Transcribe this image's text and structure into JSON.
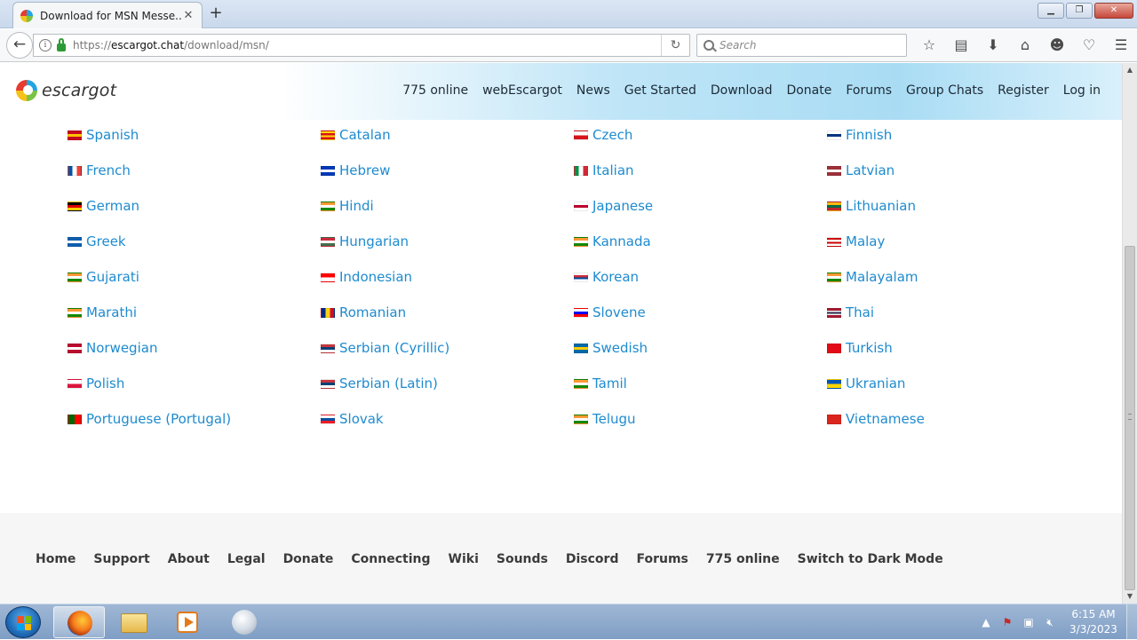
{
  "browser": {
    "tab_title": "Download for MSN Messe...",
    "tab_close": "✕",
    "new_tab": "+",
    "window_buttons": {
      "minimize": "▁",
      "maximize": "❐",
      "close": "✕"
    },
    "url_scheme": "https://",
    "url_host": "escargot.chat",
    "url_path": "/download/msn/",
    "search_placeholder": "Search",
    "toolbar_icons": [
      "bookmark-star-icon",
      "library-icon",
      "download-icon",
      "home-icon",
      "chat-icon",
      "pocket-icon",
      "menu-icon"
    ]
  },
  "site": {
    "logo_text": "escargot",
    "nav": [
      "775 online",
      "webEscargot",
      "News",
      "Get Started",
      "Download",
      "Donate",
      "Forums",
      "Group Chats",
      "Register",
      "Log in"
    ]
  },
  "languages": [
    [
      {
        "name": "Spanish",
        "flag": [
          "#c60b1e",
          "#ffc400",
          "#c60b1e"
        ]
      },
      {
        "name": "French",
        "flag": [
          "#0055a4",
          "#ffffff",
          "#ef4135"
        ],
        "vertical": true
      },
      {
        "name": "German",
        "flag": [
          "#000000",
          "#dd0000",
          "#ffce00"
        ]
      },
      {
        "name": "Greek",
        "flag": [
          "#0d5eaf",
          "#ffffff",
          "#0d5eaf"
        ]
      },
      {
        "name": "Gujarati",
        "flag": [
          "#ff9933",
          "#ffffff",
          "#138808"
        ]
      },
      {
        "name": "Marathi",
        "flag": [
          "#ff9933",
          "#ffffff",
          "#138808"
        ]
      },
      {
        "name": "Norwegian",
        "flag": [
          "#ba0c2f",
          "#ffffff",
          "#ba0c2f"
        ]
      },
      {
        "name": "Polish",
        "flag": [
          "#ffffff",
          "#dc143c"
        ]
      },
      {
        "name": "Portuguese (Portugal)",
        "flag": [
          "#006600",
          "#ff0000"
        ],
        "vertical": true
      }
    ],
    [
      {
        "name": "Catalan",
        "flag": [
          "#fcdd09",
          "#da121a",
          "#fcdd09",
          "#da121a"
        ]
      },
      {
        "name": "Hebrew",
        "flag": [
          "#0038b8",
          "#ffffff",
          "#0038b8"
        ]
      },
      {
        "name": "Hindi",
        "flag": [
          "#ff9933",
          "#ffffff",
          "#138808"
        ]
      },
      {
        "name": "Hungarian",
        "flag": [
          "#cd2a3e",
          "#ffffff",
          "#436f4d"
        ]
      },
      {
        "name": "Indonesian",
        "flag": [
          "#ff0000",
          "#ffffff"
        ]
      },
      {
        "name": "Romanian",
        "flag": [
          "#002b7f",
          "#fcd116",
          "#ce1126"
        ],
        "vertical": true
      },
      {
        "name": "Serbian (Cyrillic)",
        "flag": [
          "#c6363c",
          "#0c4076",
          "#ffffff"
        ]
      },
      {
        "name": "Serbian (Latin)",
        "flag": [
          "#c6363c",
          "#0c4076",
          "#ffffff"
        ]
      },
      {
        "name": "Slovak",
        "flag": [
          "#ffffff",
          "#0b4ea2",
          "#ee1c25"
        ]
      }
    ],
    [
      {
        "name": "Czech",
        "flag": [
          "#ffffff",
          "#d7141a"
        ]
      },
      {
        "name": "Italian",
        "flag": [
          "#009246",
          "#ffffff",
          "#ce2b37"
        ],
        "vertical": true
      },
      {
        "name": "Japanese",
        "flag": [
          "#ffffff",
          "#bc002d",
          "#ffffff"
        ]
      },
      {
        "name": "Kannada",
        "flag": [
          "#ff9933",
          "#ffffff",
          "#138808"
        ]
      },
      {
        "name": "Korean",
        "flag": [
          "#ffffff",
          "#cd2e3a",
          "#0047a0",
          "#ffffff"
        ]
      },
      {
        "name": "Slovene",
        "flag": [
          "#ffffff",
          "#0000ff",
          "#ff0000"
        ]
      },
      {
        "name": "Swedish",
        "flag": [
          "#006aa7",
          "#fecc00",
          "#006aa7"
        ]
      },
      {
        "name": "Tamil",
        "flag": [
          "#ff9933",
          "#ffffff",
          "#138808"
        ]
      },
      {
        "name": "Telugu",
        "flag": [
          "#ff9933",
          "#ffffff",
          "#138808"
        ]
      }
    ],
    [
      {
        "name": "Finnish",
        "flag": [
          "#ffffff",
          "#003580",
          "#ffffff"
        ]
      },
      {
        "name": "Latvian",
        "flag": [
          "#9e3039",
          "#ffffff",
          "#9e3039"
        ]
      },
      {
        "name": "Lithuanian",
        "flag": [
          "#fdb913",
          "#006a44",
          "#c1272d"
        ]
      },
      {
        "name": "Malay",
        "flag": [
          "#cc0001",
          "#ffffff",
          "#cc0001",
          "#ffffff"
        ]
      },
      {
        "name": "Malayalam",
        "flag": [
          "#ff9933",
          "#ffffff",
          "#138808"
        ]
      },
      {
        "name": "Thai",
        "flag": [
          "#a51931",
          "#f4f5f8",
          "#2d2a4a",
          "#f4f5f8",
          "#a51931"
        ]
      },
      {
        "name": "Turkish",
        "flag": [
          "#e30a17",
          "#e30a17"
        ]
      },
      {
        "name": "Ukranian",
        "flag": [
          "#0057b7",
          "#ffd700"
        ]
      },
      {
        "name": "Vietnamese",
        "flag": [
          "#da251d",
          "#da251d"
        ]
      }
    ]
  ],
  "footer": [
    "Home",
    "Support",
    "About",
    "Legal",
    "Donate",
    "Connecting",
    "Wiki",
    "Sounds",
    "Discord",
    "Forums",
    "775 online",
    "Switch to Dark Mode"
  ],
  "taskbar": {
    "time": "6:15 AM",
    "date": "3/3/2023",
    "tray_expand": "▲"
  }
}
